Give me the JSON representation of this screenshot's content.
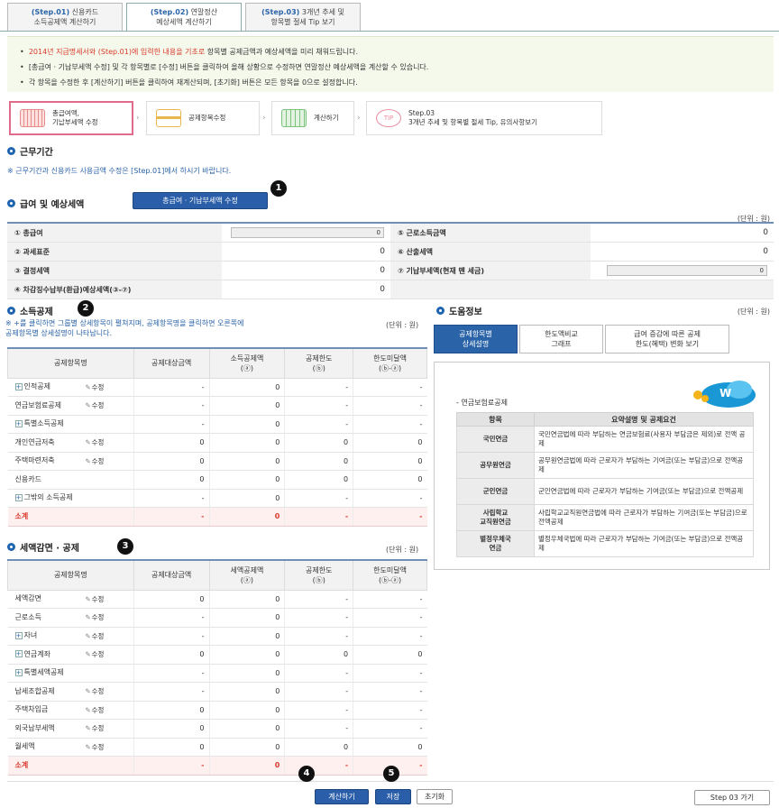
{
  "step_tabs": [
    {
      "step": "(Step.01)",
      "line1": "신용카드",
      "line2": "소득공제액 계산하기"
    },
    {
      "step": "(Step.02)",
      "line1": "연말정산",
      "line2": "예상세액 계산하기"
    },
    {
      "step": "(Step.03)",
      "line1": "3개년 추세 및",
      "line2": "항목별 절세 Tip 보기"
    }
  ],
  "notice": {
    "line1_red": "2014년 지급명세서와 (Step.01)에 입력한 내용을 기초로",
    "line1_rest": " 항목별 공제금액과 예상세액을 미리 채워드립니다.",
    "line2": "[총급여 · 기납부세액 수정] 및 각 항목별로 [수정] 버튼을 클릭하여 올해 상황으로 수정하면 연말정산 예상세액을 계산할 수 있습니다.",
    "line3": "각 항목을 수정한 후 [계산하기] 버튼을 클릭하여 재계산되며, [초기화] 버튼은 모든 항목을 0으로 설정합니다."
  },
  "flow": [
    {
      "l1": "총급여액,",
      "l2": "기납부세액 수정"
    },
    {
      "l1": "공제항목수정",
      "l2": ""
    },
    {
      "l1": "계산하기",
      "l2": ""
    },
    {
      "l1": "Step.03",
      "l2": "3개년 추세 및 항목별 절세 Tip, 유의사항보기"
    }
  ],
  "flow_tip_icon": "TIP",
  "sections": {
    "work_period": "근무기간",
    "work_note": "※ 근무기간과 신용카드 사용금액 수정은 [Step.01]에서 하시기 바랍니다.",
    "salary": "급여 및 예상세액",
    "salary_button": "총급여 · 기납부세액 수정",
    "income_deduction": "소득공제",
    "income_note1": "※ +를 클릭하면 그룹별 상세항목이 펼쳐지며, 공제항목명을 클릭하면 오른쪽에",
    "income_note2": "공제항목별 상세설명이 나타납니다.",
    "help": "도움정보",
    "tax_credit": "세액감면 · 공제",
    "unit": "(단위 : 원)"
  },
  "badges": [
    "1",
    "2",
    "3",
    "4",
    "5"
  ],
  "salary_rows": [
    {
      "l": "① 총급여",
      "v": "0",
      "input": true,
      "l2": "⑤ 근로소득금액",
      "v2": "0",
      "input2": false
    },
    {
      "l": "② 과세표준",
      "v": "0",
      "input": false,
      "l2": "⑥ 산출세액",
      "v2": "0",
      "input2": false
    },
    {
      "l": "③ 결정세액",
      "v": "0",
      "input": false,
      "l2": "⑦ 기납부세액(현재 뗀 세금)",
      "v2": "0",
      "input2": true
    },
    {
      "l": "④ 차감징수납부(환급)예상세액(③-⑦)",
      "v": "0",
      "input": false,
      "l2": "",
      "v2": "",
      "input2": false
    }
  ],
  "income_table": {
    "headers": [
      "공제항목명",
      "공제대상금액",
      "소득공제액\n(ⓐ)",
      "공제한도\n(ⓑ)",
      "한도미달액\n(ⓑ-ⓐ)"
    ],
    "edit_label": "수정",
    "rows": [
      {
        "name": "인적공제",
        "plus": true,
        "edit": true,
        "c": [
          "-",
          "0",
          "-",
          "-"
        ]
      },
      {
        "name": "연금보험료공제",
        "plus": false,
        "edit": true,
        "c": [
          "-",
          "0",
          "-",
          "-"
        ]
      },
      {
        "name": "특별소득공제",
        "plus": true,
        "edit": false,
        "c": [
          "-",
          "0",
          "-",
          "-"
        ]
      },
      {
        "name": "개인연금저축",
        "plus": false,
        "edit": true,
        "c": [
          "0",
          "0",
          "0",
          "0"
        ]
      },
      {
        "name": "주택마련저축",
        "plus": false,
        "edit": true,
        "c": [
          "0",
          "0",
          "0",
          "0"
        ]
      },
      {
        "name": "신용카드",
        "plus": false,
        "edit": false,
        "c": [
          "0",
          "0",
          "0",
          "0"
        ]
      },
      {
        "name": "그밖의 소득공제",
        "plus": true,
        "edit": false,
        "c": [
          "-",
          "0",
          "-",
          "-"
        ]
      }
    ],
    "sum": {
      "name": "소계",
      "c": [
        "-",
        "0",
        "-",
        "-"
      ]
    }
  },
  "help_tabs": [
    "공제항목별\n상세설명",
    "한도액비교\n그래프",
    "급여 증감에 따른 공제\n한도(혜택) 변화 보기"
  ],
  "help_content": {
    "title": "- 연금보험료공제",
    "logo": "W",
    "headers": [
      "항목",
      "요약설명 및 공제요건"
    ],
    "rows": [
      {
        "k": "국민연금",
        "d": "국민연금법에 따라 부담하는 연금보험료(사용자 부담금은 제외)로 전액 공제"
      },
      {
        "k": "공무원연금",
        "d": "공무원연금법에 따라 근로자가 부담하는 기여금(또는 부담금)으로 전액공제"
      },
      {
        "k": "군인연금",
        "d": "군인연금법에 따라 근로자가 부담하는 기여금(또는 부담금)으로 전액공제"
      },
      {
        "k": "사립학교\n교직원연금",
        "d": "사립학교교직원연금법에 따라 근로자가 부담하는 기여금(또는 부담금)으로 전액공제"
      },
      {
        "k": "별정우체국\n연금",
        "d": "별정우체국법에 따라 근로자가 부담하는 기여금(또는 부담금)으로 전액공제"
      }
    ]
  },
  "tax_table": {
    "headers": [
      "공제항목명",
      "공제대상금액",
      "세액공제액\n(ⓐ)",
      "공제한도\n(ⓑ)",
      "한도미달액\n(ⓑ-ⓐ)"
    ],
    "edit_label": "수정",
    "rows": [
      {
        "name": "세액감면",
        "plus": false,
        "edit": true,
        "c": [
          "0",
          "0",
          "-",
          "-"
        ]
      },
      {
        "name": "근로소득",
        "plus": false,
        "edit": true,
        "c": [
          "-",
          "0",
          "-",
          "-"
        ]
      },
      {
        "name": "자녀",
        "plus": true,
        "edit": true,
        "c": [
          "-",
          "0",
          "-",
          "-"
        ]
      },
      {
        "name": "연금계좌",
        "plus": true,
        "edit": true,
        "c": [
          "0",
          "0",
          "0",
          "0"
        ]
      },
      {
        "name": "특별세액공제",
        "plus": true,
        "edit": false,
        "c": [
          "-",
          "0",
          "-",
          "-"
        ]
      },
      {
        "name": "납세조합공제",
        "plus": false,
        "edit": true,
        "c": [
          "-",
          "0",
          "-",
          "-"
        ]
      },
      {
        "name": "주택차입금",
        "plus": false,
        "edit": true,
        "c": [
          "0",
          "0",
          "-",
          "-"
        ]
      },
      {
        "name": "외국납부세액",
        "plus": false,
        "edit": true,
        "c": [
          "0",
          "0",
          "-",
          "-"
        ]
      },
      {
        "name": "월세액",
        "plus": false,
        "edit": true,
        "c": [
          "0",
          "0",
          "0",
          "0"
        ]
      }
    ],
    "sum": {
      "name": "소계",
      "c": [
        "-",
        "0",
        "-",
        "-"
      ]
    }
  },
  "buttons": {
    "calc": "계산하기",
    "save": "저장",
    "reset": "초기화",
    "step3": "Step 03 가기"
  }
}
